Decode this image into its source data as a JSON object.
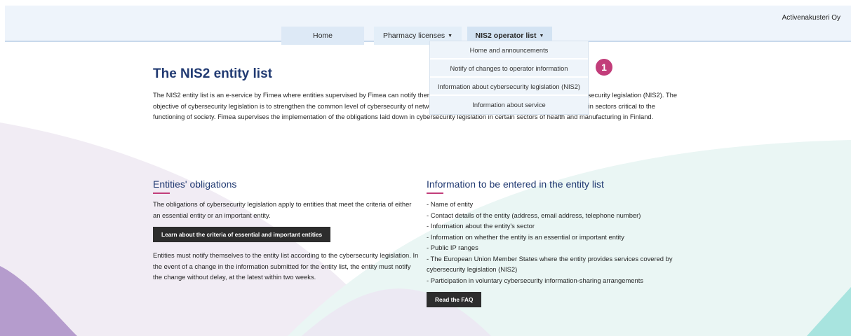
{
  "header": {
    "user_name": "Activenakusteri Oy"
  },
  "nav": {
    "home": "Home",
    "pharmacy_licenses": "Pharmacy licenses",
    "nis2_operator_list": "NIS2 operator list",
    "caret": "▼"
  },
  "dropdown": {
    "items": [
      "Home and announcements",
      "Notify of changes to operator information",
      "Information about cybersecurity legislation (NIS2)",
      "Information about service"
    ]
  },
  "badge": {
    "label": "1"
  },
  "page": {
    "title": "The NIS2 entity list",
    "intro": "The NIS2 entity list is an e-service by Fimea where entities supervised by Fimea can notify themselves according to the obligations laid down in cybersecurity legislation (NIS2). The objective of cybersecurity legislation is to strengthen the common level of cybersecurity of network and information systems in the EU Member States in sectors critical to the functioning of society. Fimea supervises the implementation of the obligations laid down in cybersecurity legislation in certain sectors of health and manufacturing in Finland."
  },
  "obligations": {
    "heading": "Entities' obligations",
    "paragraph1": "The obligations of cybersecurity legislation apply to entities that meet the criteria of either an essential entity or an important entity.",
    "button": "Learn about the criteria of essential and important entities",
    "paragraph2": "Entities must notify themselves to the entity list according to the cybersecurity legislation. In the event of a change in the information submitted for the entity list, the entity must notify the change without delay, at the latest within two weeks."
  },
  "info": {
    "heading": "Information to be entered in the entity list",
    "items": [
      "- Name of entity",
      "- Contact details of the entity (address, email address, telephone number)",
      "- Information about the entity's sector",
      "- Information on whether the entity is an essential or important entity",
      "- Public IP ranges",
      "- The European Union Member States where the entity provides services covered by cybersecurity legislation (NIS2)",
      "- Participation in voluntary cybersecurity information-sharing arrangements"
    ],
    "button": "Read the FAQ"
  }
}
